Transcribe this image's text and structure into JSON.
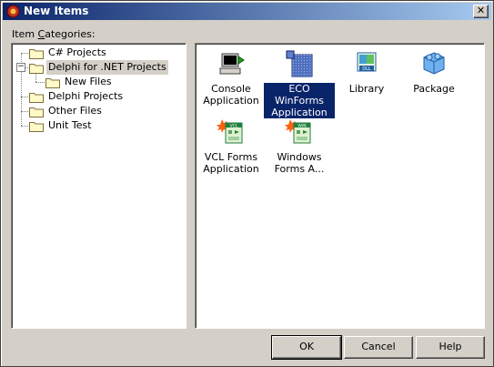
{
  "window": {
    "title": "New Items",
    "close_label": "✕"
  },
  "categories_label_pre": "Item ",
  "categories_label_u": "C",
  "categories_label_post": "ategories:",
  "tree": [
    {
      "label": "C# Projects",
      "level": 0,
      "selected": false
    },
    {
      "label": "Delphi for .NET Projects",
      "level": 0,
      "selected": true,
      "expanded": true
    },
    {
      "label": "New Files",
      "level": 1,
      "selected": false
    },
    {
      "label": "Delphi Projects",
      "level": 0,
      "selected": false
    },
    {
      "label": "Other Files",
      "level": 0,
      "selected": false
    },
    {
      "label": "Unit Test",
      "level": 0,
      "selected": false
    }
  ],
  "expander_symbol": "−",
  "items": [
    {
      "line1": "Console",
      "line2": "Application",
      "icon": "console-icon",
      "selected": false
    },
    {
      "line1": "ECO WinForms",
      "line2": "Application",
      "icon": "eco-icon",
      "selected": true
    },
    {
      "line1": "Library",
      "line2": "",
      "icon": "dll-icon",
      "selected": false
    },
    {
      "line1": "Package",
      "line2": "",
      "icon": "package-icon",
      "selected": false
    },
    {
      "line1": "VCL Forms",
      "line2": "Application",
      "icon": "vcl-forms-icon",
      "selected": false
    },
    {
      "line1": "Windows",
      "line2": "Forms A...",
      "icon": "winforms-icon",
      "selected": false
    }
  ],
  "buttons": {
    "ok": "OK",
    "cancel": "Cancel",
    "help": "Help"
  },
  "colors": {
    "title_start": "#0a246a",
    "title_end": "#a6caf0",
    "selection": "#0a246a"
  }
}
